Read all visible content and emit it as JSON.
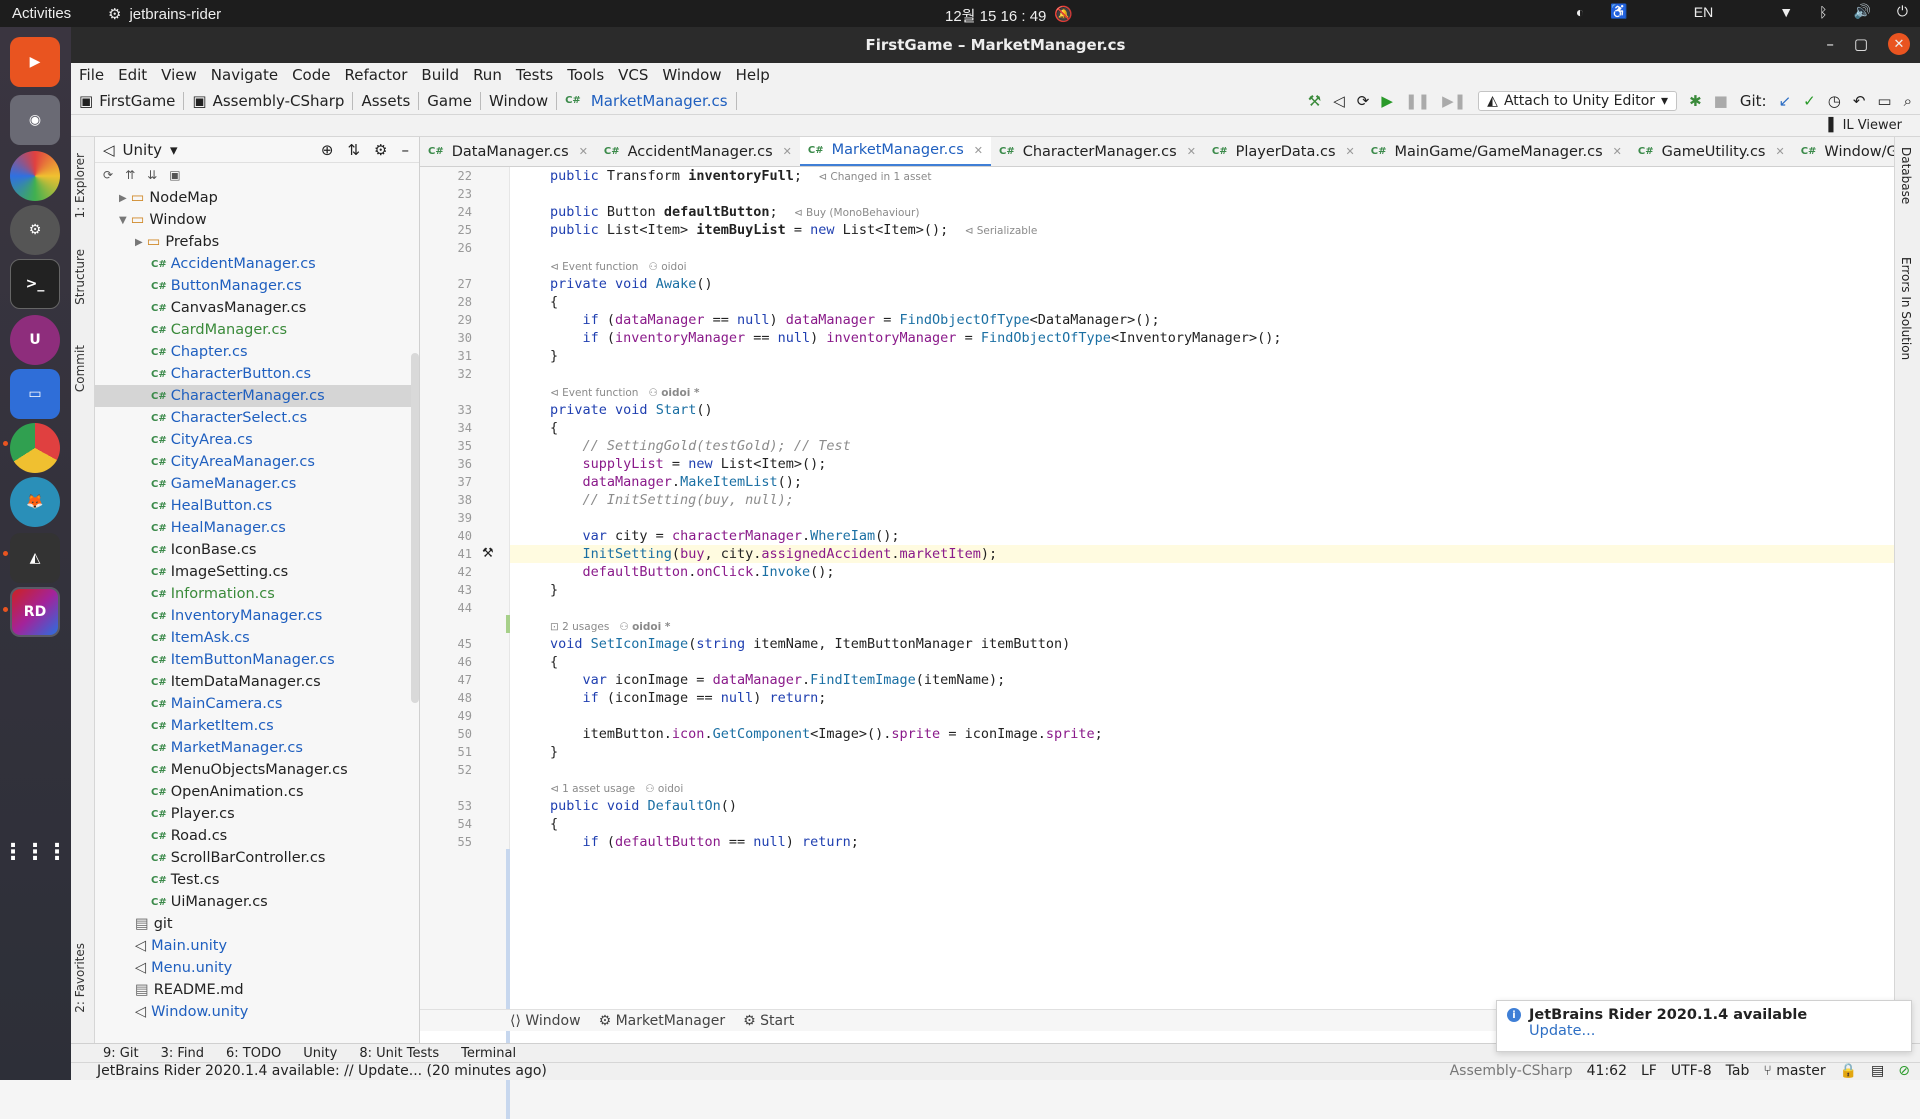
{
  "topbar": {
    "activities": "Activities",
    "app_name": "jetbrains-rider",
    "clock": "12월 15  16 : 49",
    "lang": "EN"
  },
  "window": {
    "title": "FirstGame – MarketManager.cs"
  },
  "menu": [
    "File",
    "Edit",
    "View",
    "Navigate",
    "Code",
    "Refactor",
    "Build",
    "Run",
    "Tests",
    "Tools",
    "VCS",
    "Window",
    "Help"
  ],
  "breadcrumb": [
    "FirstGame",
    "Assembly-CSharp",
    "Assets",
    "Game",
    "Window",
    "MarketManager.cs"
  ],
  "toolbar": {
    "attach_label": "Attach to Unity Editor",
    "git_label": "Git:"
  },
  "il_viewer": "IL Viewer",
  "explorer": {
    "root": "Unity",
    "tree": [
      {
        "name": "NodeMap",
        "kind": "folder",
        "indent": 2
      },
      {
        "name": "Window",
        "kind": "folder-open",
        "indent": 2
      },
      {
        "name": "Prefabs",
        "kind": "folder",
        "indent": 3
      },
      {
        "name": "AccidentManager.cs",
        "kind": "cs",
        "indent": 4
      },
      {
        "name": "ButtonManager.cs",
        "kind": "cs",
        "indent": 4
      },
      {
        "name": "CanvasManager.cs",
        "kind": "cs-plain",
        "indent": 4
      },
      {
        "name": "CardManager.cs",
        "kind": "cs-green",
        "indent": 4
      },
      {
        "name": "Chapter.cs",
        "kind": "cs",
        "indent": 4
      },
      {
        "name": "CharacterButton.cs",
        "kind": "cs",
        "indent": 4
      },
      {
        "name": "CharacterManager.cs",
        "kind": "cs",
        "indent": 4,
        "selected": true
      },
      {
        "name": "CharacterSelect.cs",
        "kind": "cs",
        "indent": 4
      },
      {
        "name": "CityArea.cs",
        "kind": "cs",
        "indent": 4
      },
      {
        "name": "CityAreaManager.cs",
        "kind": "cs",
        "indent": 4
      },
      {
        "name": "GameManager.cs",
        "kind": "cs",
        "indent": 4
      },
      {
        "name": "HealButton.cs",
        "kind": "cs",
        "indent": 4
      },
      {
        "name": "HealManager.cs",
        "kind": "cs",
        "indent": 4
      },
      {
        "name": "IconBase.cs",
        "kind": "cs-plain",
        "indent": 4
      },
      {
        "name": "ImageSetting.cs",
        "kind": "cs-plain",
        "indent": 4
      },
      {
        "name": "Information.cs",
        "kind": "cs-green",
        "indent": 4
      },
      {
        "name": "InventoryManager.cs",
        "kind": "cs",
        "indent": 4
      },
      {
        "name": "ItemAsk.cs",
        "kind": "cs",
        "indent": 4
      },
      {
        "name": "ItemButtonManager.cs",
        "kind": "cs",
        "indent": 4
      },
      {
        "name": "ItemDataManager.cs",
        "kind": "cs-plain",
        "indent": 4
      },
      {
        "name": "MainCamera.cs",
        "kind": "cs",
        "indent": 4
      },
      {
        "name": "MarketItem.cs",
        "kind": "cs",
        "indent": 4
      },
      {
        "name": "MarketManager.cs",
        "kind": "cs",
        "indent": 4
      },
      {
        "name": "MenuObjectsManager.cs",
        "kind": "cs-plain",
        "indent": 4
      },
      {
        "name": "OpenAnimation.cs",
        "kind": "cs-plain",
        "indent": 4
      },
      {
        "name": "Player.cs",
        "kind": "cs-plain",
        "indent": 4
      },
      {
        "name": "Road.cs",
        "kind": "cs-plain",
        "indent": 4
      },
      {
        "name": "ScrollBarController.cs",
        "kind": "cs-plain",
        "indent": 4
      },
      {
        "name": "Test.cs",
        "kind": "cs-plain",
        "indent": 4
      },
      {
        "name": "UiManager.cs",
        "kind": "cs-plain",
        "indent": 4
      },
      {
        "name": "git",
        "kind": "file",
        "indent": 3
      },
      {
        "name": "Main.unity",
        "kind": "unity",
        "indent": 3
      },
      {
        "name": "Menu.unity",
        "kind": "unity",
        "indent": 3
      },
      {
        "name": "README.md",
        "kind": "file",
        "indent": 3
      },
      {
        "name": "Window.unity",
        "kind": "unity",
        "indent": 3
      }
    ]
  },
  "tabs": [
    {
      "label": "DataManager.cs",
      "close": true
    },
    {
      "label": "AccidentManager.cs",
      "close": true
    },
    {
      "label": "MarketManager.cs",
      "close": true,
      "active": true
    },
    {
      "label": "CharacterManager.cs",
      "close": true
    },
    {
      "label": "PlayerData.cs",
      "close": true
    },
    {
      "label": "MainGame/GameManager.cs",
      "close": true
    },
    {
      "label": "GameUtility.cs",
      "close": true
    },
    {
      "label": "Window/GameManage",
      "close": false
    }
  ],
  "code_lines": [
    {
      "n": "22",
      "html": "<span class='kw'>public</span> Transform <b>inventoryFull</b>;  <span class='hint'>⊲ Changed in 1 asset</span>"
    },
    {
      "n": "23",
      "html": ""
    },
    {
      "n": "24",
      "html": "<span class='kw'>public</span> Button <b>defaultButton</b>;  <span class='hint'>⊲ Buy (MonoBehaviour)</span>"
    },
    {
      "n": "25",
      "html": "<span class='kw'>public</span> List&lt;Item&gt; <b>itemBuyList</b> = <span class='kw'>new</span> List&lt;Item&gt;();  <span class='hint'>⊲ Serializable</span>"
    },
    {
      "n": "26",
      "html": ""
    },
    {
      "n": "",
      "html": "<span class='hint'>⊲ Event function   ⚇ oidoi</span>"
    },
    {
      "n": "27",
      "html": "<span class='kw'>private void</span> <span class='fn'>Awake</span>()"
    },
    {
      "n": "28",
      "html": "{"
    },
    {
      "n": "29",
      "html": "    <span class='kw'>if</span> (<span class='fld'>dataManager</span> == <span class='kw'>null</span>) <span class='fld'>dataManager</span> = <span class='fn'>FindObjectOfType</span>&lt;DataManager&gt;();"
    },
    {
      "n": "30",
      "html": "    <span class='kw'>if</span> (<span class='fld'>inventoryManager</span> == <span class='kw'>null</span>) <span class='fld'>inventoryManager</span> = <span class='fn'>FindObjectOfType</span>&lt;InventoryManager&gt;();"
    },
    {
      "n": "31",
      "html": "}"
    },
    {
      "n": "32",
      "html": ""
    },
    {
      "n": "",
      "html": "<span class='hint'>⊲ Event function   ⚇ <b>oidoi *</b></span>"
    },
    {
      "n": "33",
      "html": "<span class='kw'>private void</span> <span class='fn'>Start</span>()"
    },
    {
      "n": "34",
      "html": "{"
    },
    {
      "n": "35",
      "html": "    <span class='cm'>// SettingGold(testGold); // Test</span>"
    },
    {
      "n": "36",
      "html": "    <span class='fld'>supplyList</span> = <span class='kw'>new</span> List&lt;Item&gt;();"
    },
    {
      "n": "37",
      "html": "    <span class='fld'>dataManager</span>.<span class='fn'>MakeItemList</span>();"
    },
    {
      "n": "38",
      "html": "    <span class='cm'>// InitSetting(buy, null);</span>"
    },
    {
      "n": "39",
      "html": ""
    },
    {
      "n": "40",
      "html": "    <span class='kw'>var</span> city = <span class='fld'>characterManager</span>.<span class='fn'>WhereIam</span>();"
    },
    {
      "n": "41",
      "html": "    <span class='fn'>InitSetting</span>(<span class='fld'>buy</span>, city.<span class='fld'>assignedAccident</span>.<span class='fld'>marketItem</span>);",
      "current": true
    },
    {
      "n": "42",
      "html": "    <span class='fld'>defaultButton</span>.<span class='fld'>onClick</span>.<span class='fn'>Invoke</span>();"
    },
    {
      "n": "43",
      "html": "}"
    },
    {
      "n": "44",
      "html": ""
    },
    {
      "n": "",
      "html": "<span class='hint'>⊡ 2 usages   ⚇ <b>oidoi *</b></span>"
    },
    {
      "n": "45",
      "html": "<span class='kw'>void</span> <span class='fn'>SetIconImage</span>(<span class='kw'>string</span> itemName, ItemButtonManager itemButton)"
    },
    {
      "n": "46",
      "html": "{"
    },
    {
      "n": "47",
      "html": "    <span class='kw'>var</span> iconImage = <span class='fld'>dataManager</span>.<span class='fn'>FindItemImage</span>(itemName);"
    },
    {
      "n": "48",
      "html": "    <span class='kw'>if</span> (iconImage == <span class='kw'>null</span>) <span class='kw'>return</span>;"
    },
    {
      "n": "49",
      "html": ""
    },
    {
      "n": "50",
      "html": "    itemButton.<span class='fld'>icon</span>.<span class='fn'>GetComponent</span>&lt;Image&gt;().<span class='fld'>sprite</span> = iconImage.<span class='fld'>sprite</span>;"
    },
    {
      "n": "51",
      "html": "}"
    },
    {
      "n": "52",
      "html": ""
    },
    {
      "n": "",
      "html": "<span class='hint'>⊲ 1 asset usage   ⚇ oidoi</span>"
    },
    {
      "n": "53",
      "html": "<span class='kw'>public void</span> <span class='fn'>DefaultOn</span>()"
    },
    {
      "n": "54",
      "html": "{"
    },
    {
      "n": "55",
      "html": "    <span class='kw'>if</span> (<span class='fld'>defaultButton</span> == <span class='kw'>null</span>) <span class='kw'>return</span>;"
    }
  ],
  "editor_breadcrumb": [
    "Window",
    "MarketManager",
    "Start"
  ],
  "bottom_tools": [
    "9: Git",
    "3: Find",
    "6: TODO",
    "Unity",
    "8: Unit Tests",
    "Terminal"
  ],
  "status": {
    "message": "JetBrains Rider 2020.1.4 available: // Update... (20 minutes ago)",
    "project": "Assembly-CSharp",
    "position": "41:62",
    "line_sep": "LF",
    "encoding": "UTF-8",
    "indent": "Tab",
    "branch": "master"
  },
  "popup": {
    "title": "JetBrains Rider 2020.1.4 available",
    "link": "Update..."
  },
  "side_tabs": {
    "left": [
      "1: Explorer",
      "Structure",
      "Commit",
      "2: Favorites"
    ],
    "right": [
      "Database",
      "Errors In Solution"
    ]
  }
}
